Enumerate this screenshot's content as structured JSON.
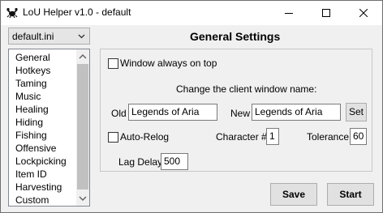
{
  "window": {
    "title": "LoU Helper v1.0 - default",
    "icon": "lobster-icon"
  },
  "profile_select": {
    "value": "default.ini"
  },
  "nav_list": {
    "items": [
      "General",
      "Hotkeys",
      "Taming",
      "Music",
      "Healing",
      "Hiding",
      "Fishing",
      "Offensive",
      "Lockpicking",
      "Item ID",
      "Harvesting",
      "Custom"
    ],
    "selected": "General"
  },
  "general": {
    "heading": "General Settings",
    "always_on_top_label": "Window always on top",
    "always_on_top_checked": false,
    "rename_caption": "Change the client window name:",
    "old_label": "Old",
    "old_value": "Legends of Aria",
    "new_label": "New",
    "new_value": "Legends of Aria",
    "set_label": "Set",
    "auto_relog_label": "Auto-Relog",
    "auto_relog_checked": false,
    "character_label": "Character #",
    "character_value": "1",
    "tolerance_label": "Tolerance",
    "tolerance_value": "60",
    "lag_delay_label": "Lag Delay",
    "lag_delay_value": "500"
  },
  "footer": {
    "save_label": "Save",
    "start_label": "Start"
  }
}
